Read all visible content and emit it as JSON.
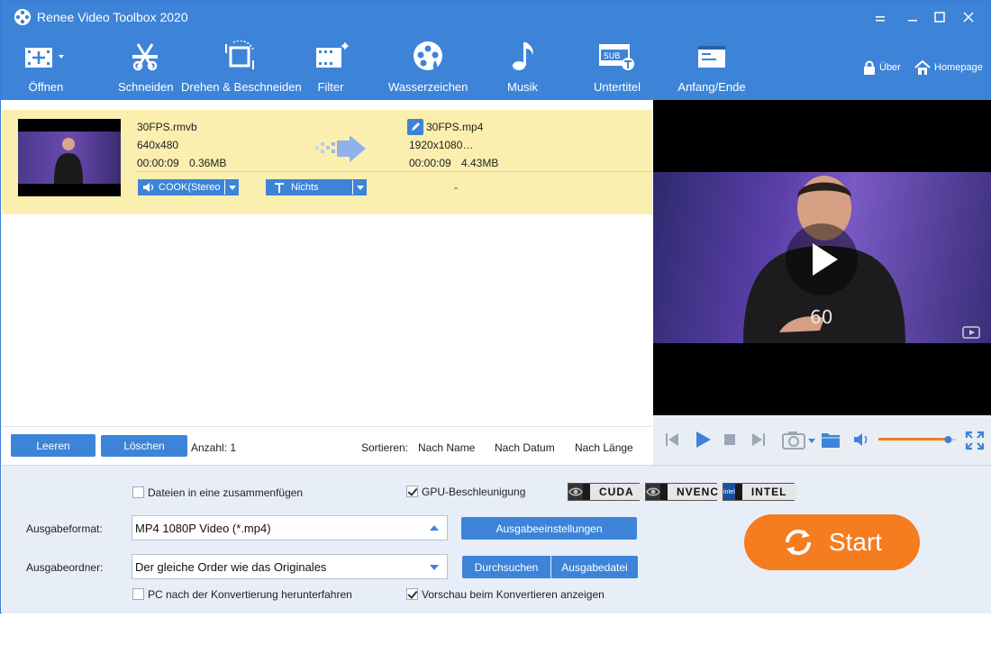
{
  "window": {
    "title": "Renee Video Toolbox 2020"
  },
  "toolbar": {
    "open": "Öffnen",
    "cut": "Schneiden",
    "rotate": "Drehen & Beschneiden",
    "filter": "Filter",
    "watermark": "Wasserzeichen",
    "music": "Musik",
    "subtitle": "Untertitel",
    "startend": "Anfang/Ende",
    "about": "Über",
    "homepage": "Homepage"
  },
  "file": {
    "source_name": "30FPS.rmvb",
    "source_res": "640x480",
    "source_duration": "00:00:09",
    "source_size": "0.36MB",
    "audio_track": "COOK(Stereo",
    "subtitle_track": "Nichts",
    "output_name": "30FPS.mp4",
    "output_res": "1920x1080…",
    "output_duration": "00:00:09",
    "output_size": "4.43MB",
    "output_dash": "-"
  },
  "listbar": {
    "clear": "Leeren",
    "delete": "Löschen",
    "count": "Anzahl: 1",
    "sort_label": "Sortieren:",
    "sort_name": "Nach Name",
    "sort_date": "Nach Datum",
    "sort_length": "Nach Länge"
  },
  "preview": {
    "overlay_text": "60",
    "volume": 0.9
  },
  "settings": {
    "merge_files": "Dateien in eine zusammenfügen",
    "merge_checked": false,
    "gpu": "GPU-Beschleunigung",
    "gpu_checked": true,
    "badges": [
      "CUDA",
      "NVENC",
      "INTEL"
    ],
    "badge_logo_intel": "intel",
    "format_label": "Ausgabeformat:",
    "format_value": "MP4 1080P Video (*.mp4)",
    "output_settings": "Ausgabeeinstellungen",
    "folder_label": "Ausgabeordner:",
    "folder_value": "Der gleiche Order wie das Originales",
    "browse": "Durchsuchen",
    "output_file": "Ausgabedatei",
    "shutdown": "PC nach der Konvertierung herunterfahren",
    "shutdown_checked": false,
    "preview_convert": "Vorschau beim Konvertieren anzeigen",
    "preview_checked": true,
    "start": "Start"
  },
  "colors": {
    "accent": "#3d84d8",
    "row_highlight": "#faefaf",
    "start": "#f57c1f"
  }
}
